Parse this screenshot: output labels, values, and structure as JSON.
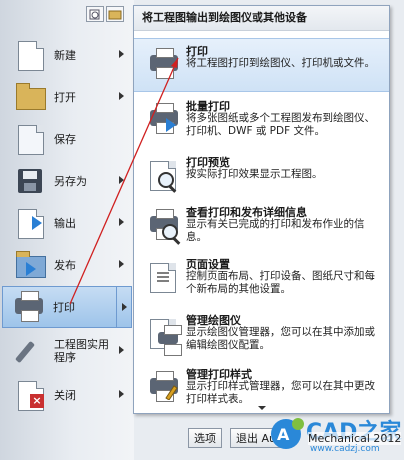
{
  "left_menu": {
    "items": [
      {
        "label": "新建",
        "icon": "new-page-icon"
      },
      {
        "label": "打开",
        "icon": "open-folder-icon"
      },
      {
        "label": "保存",
        "icon": "save-disk-icon"
      },
      {
        "label": "另存为",
        "icon": "save-as-icon"
      },
      {
        "label": "输出",
        "icon": "export-icon"
      },
      {
        "label": "发布",
        "icon": "publish-icon"
      },
      {
        "label": "打印",
        "icon": "printer-icon"
      },
      {
        "label": "工程图实用程序",
        "label_line1": "工程图实用",
        "label_line2": "程序",
        "icon": "drawing-utilities-icon"
      },
      {
        "label": "关闭",
        "icon": "close-drawing-icon"
      }
    ]
  },
  "flyout": {
    "header": "将工程图输出到绘图仪或其他设备",
    "items": [
      {
        "title": "打印",
        "desc": "将工程图打印到绘图仪、打印机或文件。",
        "icon": "printer-icon"
      },
      {
        "title": "批量打印",
        "desc": "将多张图纸或多个工程图发布到绘图仪、打印机、DWF 或 PDF 文件。",
        "icon": "batch-plot-icon"
      },
      {
        "title": "打印预览",
        "desc": "按实际打印效果显示工程图。",
        "icon": "plot-preview-icon"
      },
      {
        "title": "查看打印和发布详细信息",
        "desc": "显示有关已完成的打印和发布作业的信息。",
        "icon": "plot-details-icon"
      },
      {
        "title": "页面设置",
        "desc": "控制页面布局、打印设备、图纸尺寸和每个新布局的其他设置。",
        "icon": "page-setup-icon"
      },
      {
        "title": "管理绘图仪",
        "desc": "显示绘图仪管理器，您可以在其中添加或编辑绘图仪配置。",
        "icon": "plotter-manager-icon"
      },
      {
        "title": "管理打印样式",
        "desc": "显示打印样式管理器，您可以在其中更改打印样式表。",
        "icon": "plot-styles-icon"
      }
    ]
  },
  "bottom": {
    "options_label": "选项",
    "exit_label": "退出 Au",
    "product_text": "Mechanical 2012"
  },
  "watermark": {
    "brand": "CAD之家",
    "url": "www.cadzj.com"
  },
  "colors": {
    "accent": "#2a7fd4",
    "active_bg": "#9ec4ea",
    "annotation_arrow": "#d02020"
  }
}
